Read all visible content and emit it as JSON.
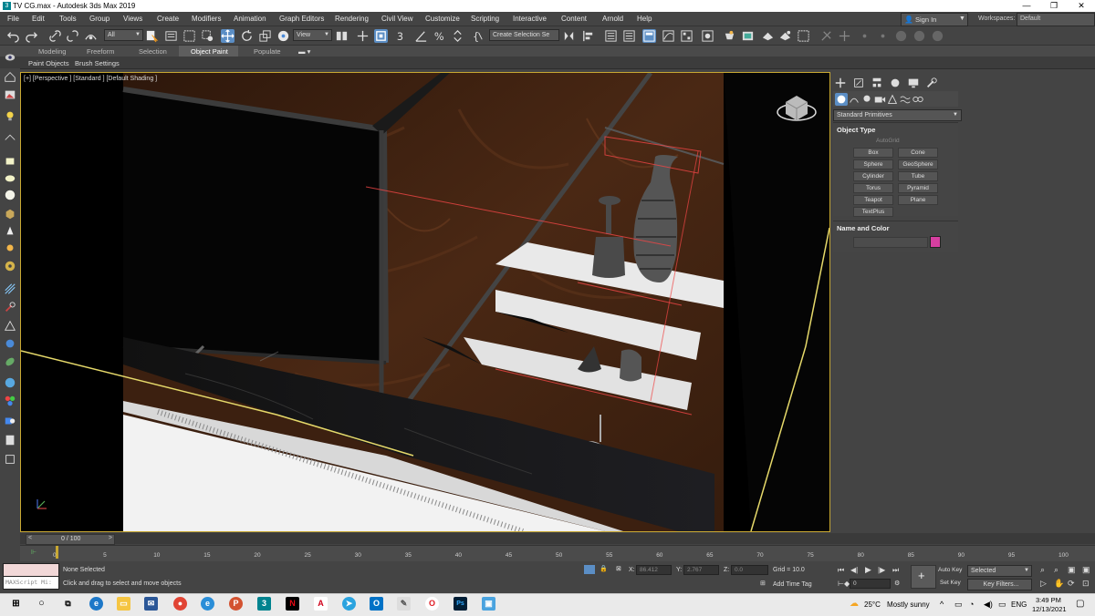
{
  "window": {
    "title": "TV CG.max - Autodesk 3ds Max 2019",
    "minimize": "—",
    "maximize": "❐",
    "close": "✕"
  },
  "menu": [
    "File",
    "Edit",
    "Tools",
    "Group",
    "Views",
    "Create",
    "Modifiers",
    "Animation",
    "Graph Editors",
    "Rendering",
    "Civil View",
    "Customize",
    "Scripting",
    "Interactive",
    "Content",
    "Arnold",
    "Help"
  ],
  "account": {
    "signin": "Sign In",
    "workspaces_label": "Workspaces:",
    "workspace": "Default"
  },
  "toolbar": {
    "filter": "All",
    "refcoord": "View",
    "selection_set": "Create Selection Se"
  },
  "ribbon": {
    "tabs": [
      "Modeling",
      "Freeform",
      "Selection",
      "Object Paint",
      "Populate"
    ],
    "active_tab": "Object Paint",
    "subtabs": [
      "Paint Objects",
      "Brush Settings"
    ]
  },
  "viewport": {
    "label": "[+] [Perspective ] [Standard ] [Default Shading ]"
  },
  "command_panel": {
    "category": "Standard Primitives",
    "object_type_title": "Object Type",
    "autogrid": "AutoGrid",
    "buttons": [
      "Box",
      "Cone",
      "Sphere",
      "GeoSphere",
      "Cylinder",
      "Tube",
      "Torus",
      "Pyramid",
      "Teapot",
      "Plane",
      "TextPlus"
    ],
    "name_color_title": "Name and Color",
    "object_color": "#d63fa0"
  },
  "timeline": {
    "frame": "0 / 100",
    "ticks": [
      "0",
      "5",
      "10",
      "15",
      "20",
      "25",
      "30",
      "35",
      "40",
      "45",
      "50",
      "55",
      "60",
      "65",
      "70",
      "75",
      "80",
      "85",
      "90",
      "95",
      "100"
    ]
  },
  "status": {
    "maxscript": "MAXScript Mi:",
    "selection": "None Selected",
    "prompt": "Click and drag to select and move objects",
    "x_label": "X:",
    "x_value": "86.412",
    "y_label": "Y:",
    "y_value": "2.767",
    "z_label": "Z:",
    "z_value": "0.0",
    "grid": "Grid = 10.0",
    "add_time_tag": "Add Time Tag",
    "auto_key": "Auto Key",
    "set_key": "Set Key",
    "key_mode": "Selected",
    "key_filters": "Key Filters...",
    "frame_spinner": "0"
  },
  "taskbar": {
    "weather_temp": "25°C",
    "weather_desc": "Mostly sunny",
    "lang": "ENG",
    "time": "3:49 PM",
    "date": "12/13/2021"
  }
}
